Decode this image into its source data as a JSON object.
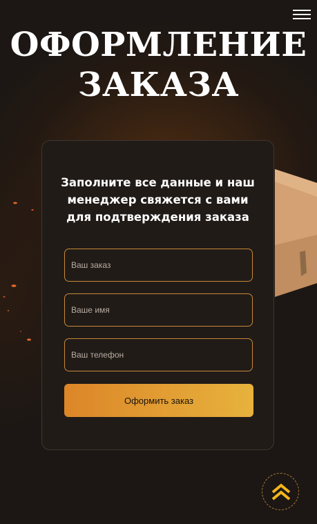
{
  "header": {
    "menu_icon": "hamburger-menu-icon",
    "title_line1": "ОФОРМЛЕНИЕ",
    "title_line2": "ЗАКАЗА"
  },
  "form": {
    "heading": "Заполните все данные и наш менеджер свяжется с вами для подтверждения заказа",
    "order_placeholder": "Ваш заказ",
    "name_placeholder": "Ваше имя",
    "phone_placeholder": "Ваш телефон",
    "submit_label": "Оформить заказ"
  },
  "scroll_top": {
    "icon": "double-chevron-up-icon"
  },
  "colors": {
    "background": "#1c1714",
    "card_background": "#211b18",
    "accent_border": "#c88a36",
    "button_gradient_start": "#dc8628",
    "button_gradient_end": "#e7b23d",
    "chevron": "#f2b51c"
  }
}
